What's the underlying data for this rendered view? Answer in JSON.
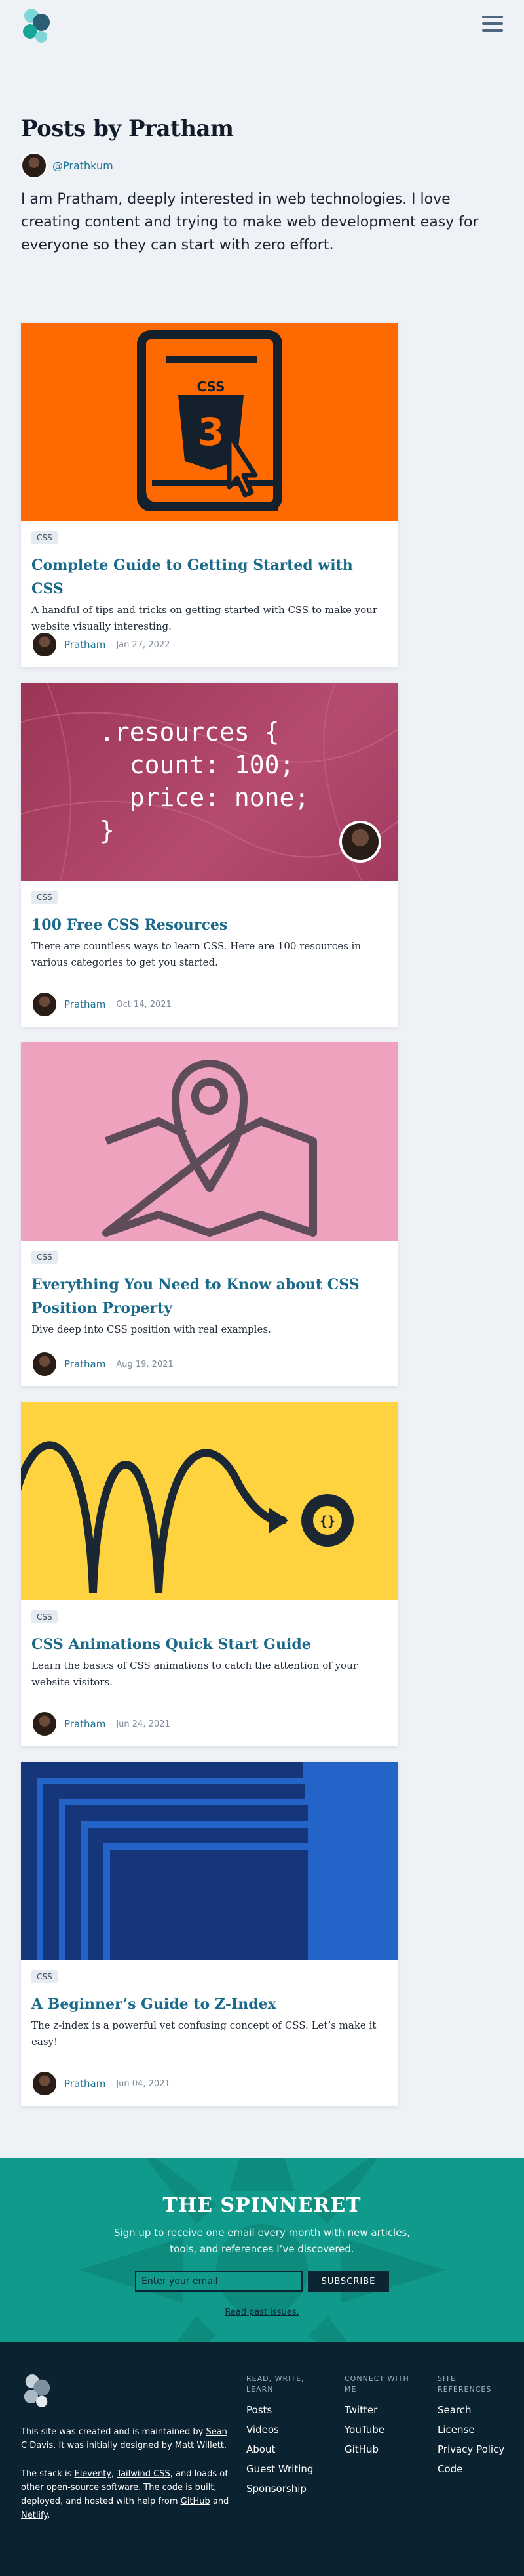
{
  "header": {
    "logo_alt": "Spinning logo",
    "menu_icon": "hamburger-menu-icon"
  },
  "intro": {
    "title": "Posts by Pratham",
    "handle": "@Prathkum",
    "bio": "I am Pratham, deeply interested in web technologies. I love creating content and trying to make web development easy for everyone so they can start with zero effort."
  },
  "posts": [
    {
      "tag": "CSS",
      "title": "Complete Guide to Getting Started with CSS",
      "excerpt": "A handful of tips and tricks on getting started with CSS to make your website visually interesting.",
      "author": "Pratham",
      "date": "Jan 27, 2022",
      "cover_color": "#ff6a00"
    },
    {
      "tag": "CSS",
      "title": "100 Free CSS Resources",
      "excerpt": "There are countless ways to learn CSS. Here are 100 resources in various categories to get you started.",
      "author": "Pratham",
      "date": "Oct 14, 2021",
      "cover_color": "#a83f62",
      "cover_code": [
        ".resources {",
        "  count: 100;",
        "  price: none;",
        "}"
      ]
    },
    {
      "tag": "CSS",
      "title": "Everything You Need to Know about CSS Position Property",
      "excerpt": "Dive deep into CSS position with real examples.",
      "author": "Pratham",
      "date": "Aug 19, 2021",
      "cover_color": "#eea2bd"
    },
    {
      "tag": "CSS",
      "title": "CSS Animations Quick Start Guide",
      "excerpt": "Learn the basics of CSS animations to catch the attention of your website visitors.",
      "author": "Pratham",
      "date": "Jun 24, 2021",
      "cover_color": "#ffd23f",
      "cover_glyph": "{}"
    },
    {
      "tag": "CSS",
      "title": "A Beginner’s Guide to Z-Index",
      "excerpt": "The z-index is a powerful yet confusing concept of CSS. Let’s make it easy!",
      "author": "Pratham",
      "date": "Jun 04, 2021",
      "cover_color": "#2463c7"
    }
  ],
  "newsletter": {
    "title": "THE SPINNERET",
    "text": "Sign up to receive one email every month with new articles, tools, and references I’ve discovered.",
    "placeholder": "Enter your email",
    "button": "SUBSCRIBE",
    "link": "Read past issues."
  },
  "footer": {
    "about_1_prefix": "This site was created and is maintained by ",
    "about_1_link": "Sean C Davis",
    "about_1_mid": ". It was initially designed by ",
    "about_1_link2": "Matt Willett",
    "about_1_end": ".",
    "about_2_prefix": "The stack is ",
    "about_2_link1": "Eleventy",
    "about_2_sep1": ", ",
    "about_2_link2": "Tailwind CSS",
    "about_2_mid": ", and loads of other open-source software. The code is built, deployed, and hosted with help from ",
    "about_2_link3": "GitHub",
    "about_2_and": " and ",
    "about_2_link4": "Netlify",
    "about_2_end": ".",
    "columns": [
      {
        "heading": "READ, WRITE, LEARN",
        "links": [
          "Posts",
          "Videos",
          "About",
          "Guest Writing",
          "Sponsorship"
        ]
      },
      {
        "heading": "CONNECT WITH ME",
        "links": [
          "Twitter",
          "YouTube",
          "GitHub"
        ]
      },
      {
        "heading": "SITE REFERENCES",
        "links": [
          "Search",
          "License",
          "Privacy Policy",
          "Code"
        ]
      }
    ]
  }
}
